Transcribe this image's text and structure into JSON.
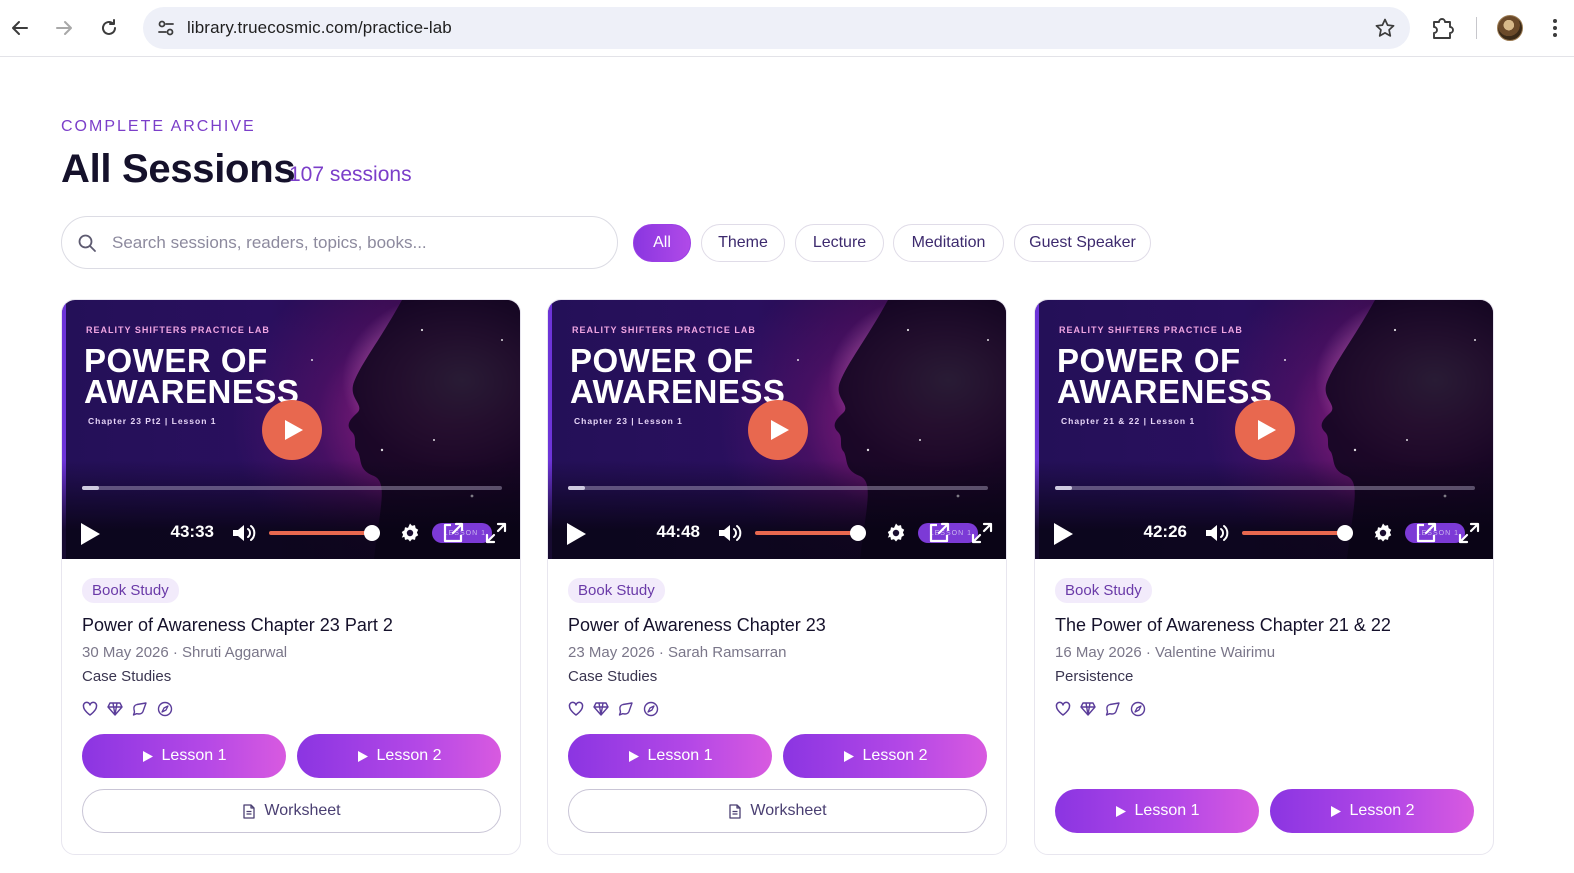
{
  "browser": {
    "url": "library.truecosmic.com/practice-lab"
  },
  "header": {
    "eyebrow": "COMPLETE ARCHIVE",
    "title": "All Sessions",
    "count": "107 sessions"
  },
  "search": {
    "placeholder": "Search sessions, readers, topics, books..."
  },
  "filters": [
    {
      "label": "All",
      "active": true
    },
    {
      "label": "Theme",
      "active": false
    },
    {
      "label": "Lecture",
      "active": false
    },
    {
      "label": "Meditation",
      "active": false
    },
    {
      "label": "Guest Speaker",
      "active": false
    }
  ],
  "cards": [
    {
      "cover": {
        "brand": "REALITY SHIFTERS PRACTICE LAB",
        "title_line1": "POWER OF",
        "title_line2": "AWARENESS",
        "subtitle": "Chapter  23 Pt2 |  Lesson 1",
        "pill": "LESSON 1"
      },
      "player": {
        "time": "43:33",
        "progress": 0.04,
        "volume": 1.0
      },
      "tag": "Book Study",
      "title": "Power of Awareness Chapter 23 Part 2",
      "meta": "30 May 2026 · Shruti Aggarwal",
      "topic": "Case Studies",
      "lesson1": "Lesson 1",
      "lesson2": "Lesson 2",
      "worksheet": "Worksheet"
    },
    {
      "cover": {
        "brand": "REALITY SHIFTERS PRACTICE LAB",
        "title_line1": "POWER OF",
        "title_line2": "AWARENESS",
        "subtitle": "Chapter  23 |  Lesson 1",
        "pill": "LESSON 1"
      },
      "player": {
        "time": "44:48",
        "progress": 0.04,
        "volume": 1.0
      },
      "tag": "Book Study",
      "title": "Power of Awareness Chapter 23",
      "meta": "23 May 2026 · Sarah Ramsarran",
      "topic": "Case Studies",
      "lesson1": "Lesson 1",
      "lesson2": "Lesson 2",
      "worksheet": "Worksheet"
    },
    {
      "cover": {
        "brand": "REALITY SHIFTERS PRACTICE LAB",
        "title_line1": "POWER OF",
        "title_line2": "AWARENESS",
        "subtitle": "Chapter 21 & 22 |  Lesson 1",
        "pill": "LESSON 1"
      },
      "player": {
        "time": "42:26",
        "progress": 0.04,
        "volume": 1.0
      },
      "tag": "Book Study",
      "title": "The Power of Awareness Chapter 21 & 22",
      "meta": "16 May 2026 · Valentine Wairimu",
      "topic": "Persistence",
      "lesson1": "Lesson 1",
      "lesson2": "Lesson 2"
    }
  ],
  "icons": {
    "back": "arrow-left-icon",
    "forward": "arrow-right-icon",
    "reload": "reload-icon",
    "site_info": "tune-icon",
    "bookmark": "star-icon",
    "extensions": "puzzle-icon",
    "menu": "kebab-icon",
    "search": "search-icon",
    "card_actions": [
      "heart-icon",
      "gem-icon",
      "comment-icon",
      "compass-icon"
    ]
  },
  "colors": {
    "accent": "#8a36e0",
    "accent_text": "#7b3ec9",
    "play_button": "#e8684f",
    "tag_bg": "#f2ebfb"
  }
}
